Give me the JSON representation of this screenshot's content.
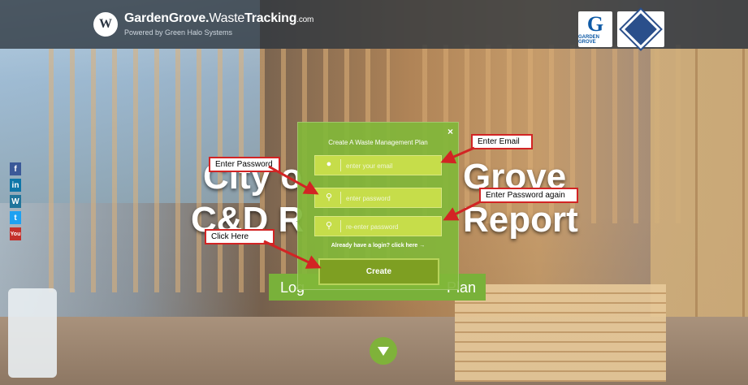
{
  "header": {
    "logo_mark": "W",
    "logo_brand": "GardenGrove.",
    "logo_waste": "Waste",
    "logo_tracking": "Tracking",
    "logo_com": ".com",
    "logo_sub": "Powered by Green Halo Systems",
    "partner_logo_letter": "G",
    "partner_logo_text": "GARDEN GROVE"
  },
  "social": [
    {
      "icon": "facebook-icon",
      "glyph": "f",
      "color": "#3b5998"
    },
    {
      "icon": "linkedin-icon",
      "glyph": "in",
      "color": "#0e76a8"
    },
    {
      "icon": "wordpress-icon",
      "glyph": "W",
      "color": "#21759b"
    },
    {
      "icon": "twitter-icon",
      "glyph": "t",
      "color": "#1da1f2"
    },
    {
      "icon": "youtube-icon",
      "glyph": "You",
      "color": "#c4302b"
    }
  ],
  "hero": {
    "line1_left": "City o",
    "line1_right": "Grove",
    "line2_left": "C&D R",
    "line2_right": "Report"
  },
  "cta": {
    "left": "Log",
    "right": "Plan"
  },
  "modal": {
    "close": "×",
    "title": "Create A Waste Management Plan",
    "email_placeholder": "enter your email",
    "password_placeholder": "enter password",
    "password2_placeholder": "re-enter password",
    "login_link": "Already have a login? click here →",
    "create_label": "Create"
  },
  "callouts": {
    "email": "Enter Email",
    "password": "Enter Password",
    "password2": "Enter Password again",
    "click": "Click Here"
  },
  "colors": {
    "accent_green": "#79b13a",
    "callout_border": "#d22424"
  }
}
